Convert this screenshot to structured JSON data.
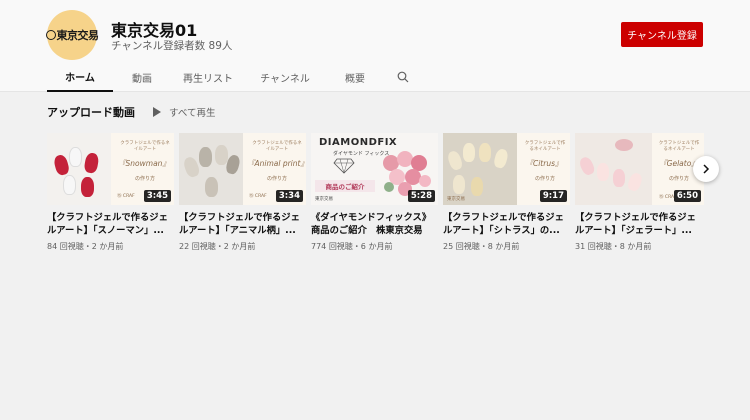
{
  "channel": {
    "name": "東京交易01",
    "subscribers": "チャンネル登録者数 89人",
    "avatar_text": "東京交易",
    "subscribe_label": "チャンネル登録"
  },
  "tabs": [
    {
      "label": "ホーム",
      "active": true
    },
    {
      "label": "動画"
    },
    {
      "label": "再生リスト"
    },
    {
      "label": "チャンネル"
    },
    {
      "label": "概要"
    }
  ],
  "section": {
    "title": "アップロード動画",
    "play_all": "すべて再生"
  },
  "videos": [
    {
      "title": "【クラフトジェルで作るジェルアート】「スノーマン」...",
      "meta": "84 回視聴・2 か月前",
      "duration": "3:45",
      "thumb_text": "クラフトジェルで作るネイルアート",
      "thumb_title": "『Snowman』",
      "thumb_sub": "の作り方",
      "thumb_brand": "⑮ CRAF"
    },
    {
      "title": "【クラフトジェルで作るジェルアート】「アニマル柄」...",
      "meta": "22 回視聴・2 か月前",
      "duration": "3:34",
      "thumb_text": "クラフトジェルで作るネイルアート",
      "thumb_title": "『Animal print』",
      "thumb_sub": "の作り方",
      "thumb_brand": "⑮ CRAF"
    },
    {
      "title": "《ダイヤモンドフィックス》商品のご紹介　株東京交易",
      "meta": "774 回視聴・6 か月前",
      "duration": "5:28",
      "thumb_head": "DIAMONDFIX",
      "thumb_sub": "ダイヤモンド フィックス",
      "thumb_tag": "商品のご紹介",
      "thumb_brand": "東京交易"
    },
    {
      "title": "【クラフトジェルで作るジェルアート】「シトラス」の...",
      "meta": "25 回視聴・8 か月前",
      "duration": "9:17",
      "thumb_text": "クラフトジェルで作るネイルアート",
      "thumb_title": "『Citrus』",
      "thumb_sub": "の作り方",
      "thumb_brand": "東京交易"
    },
    {
      "title": "【クラフトジェルで作るジェルアート】「ジェラート」...",
      "meta": "31 回視聴・8 か月前",
      "duration": "6:50",
      "thumb_text": "クラフトジェルで作るネイルアート",
      "thumb_title": "『Gelato』",
      "thumb_sub": "の作り方",
      "thumb_brand": "⑮ CRA"
    }
  ],
  "colors": {
    "subscribe": "#cc0000",
    "background": "#f1f1f1",
    "header": "#f9f9f9"
  },
  "icons": {
    "search": "search-icon",
    "play": "play-icon",
    "next": "chevron-right-icon"
  }
}
